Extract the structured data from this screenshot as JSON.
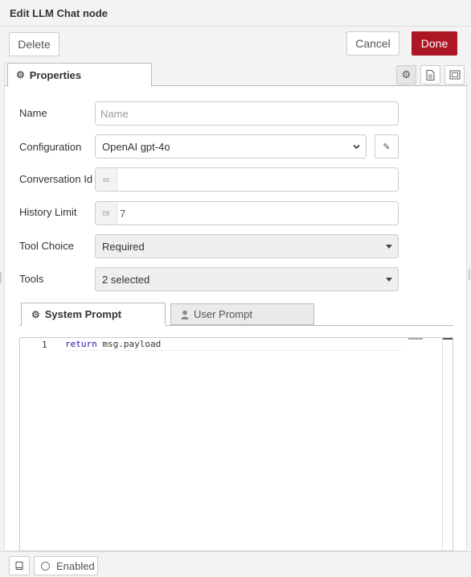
{
  "window": {
    "title": "Edit LLM Chat node"
  },
  "toolbar": {
    "delete_label": "Delete",
    "cancel_label": "Cancel",
    "done_label": "Done"
  },
  "tabs": {
    "properties_label": "Properties"
  },
  "form": {
    "name": {
      "label": "Name",
      "placeholder": "Name",
      "value": ""
    },
    "configuration": {
      "label": "Configuration",
      "value": "OpenAI gpt-4o"
    },
    "conversation_id": {
      "label": "Conversation Id",
      "type_badge": "az",
      "value": ""
    },
    "history_limit": {
      "label": "History Limit",
      "type_badge": "09",
      "value": "7"
    },
    "tool_choice": {
      "label": "Tool Choice",
      "value": "Required"
    },
    "tools": {
      "label": "Tools",
      "value": "2 selected"
    }
  },
  "prompt_tabs": {
    "system_label": "System Prompt",
    "user_label": "User Prompt"
  },
  "editor": {
    "line_number": "1",
    "code_keyword": "return",
    "code_rest": " msg.payload"
  },
  "footer": {
    "enabled_label": "Enabled"
  },
  "colors": {
    "done_bg": "#ad1625",
    "panel_bg": "#ffffff",
    "chrome_bg": "#f3f3f3"
  },
  "icons": {
    "gear": "gear-icon",
    "doc": "document-icon",
    "frame": "frame-icon",
    "pencil": "pencil-icon",
    "user": "user-icon",
    "book": "book-icon"
  }
}
